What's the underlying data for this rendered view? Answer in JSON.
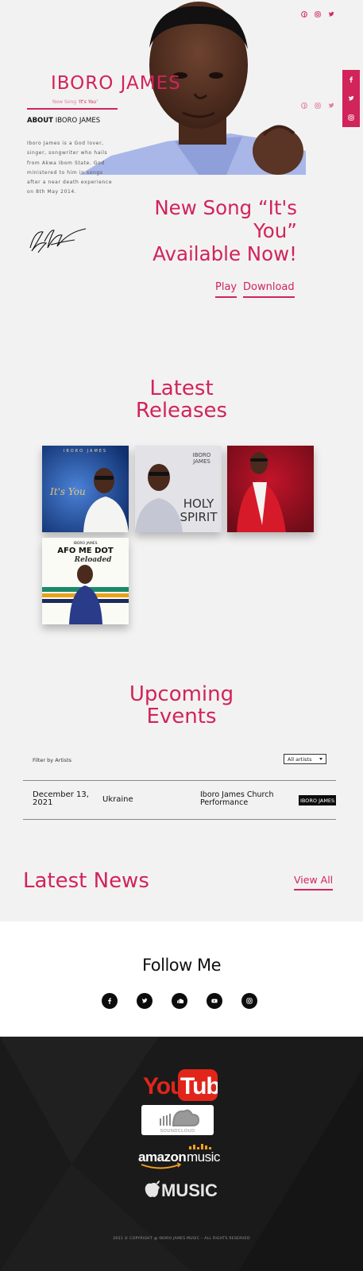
{
  "header": {
    "artist_name": "IBORO JAMES",
    "new_song_prefix": "New Song",
    "new_song_title": "‘It's You’",
    "about_label_bold": "ABOUT",
    "about_label_rest": "IBORO JAMES",
    "about_text": "Iboro James is a God lover, singer, songwriter who hails from Akwa Ibom State. God ministered to him in songs after a near death experience on 8th May 2014.",
    "social_icons": [
      "facebook-icon",
      "instagram-icon",
      "twitter-icon"
    ],
    "share_icons": [
      "facebook-icon",
      "twitter-icon",
      "instagram-icon"
    ]
  },
  "announcement": {
    "line1": "New Song “It's",
    "line2": "You”",
    "line3": "Available Now!",
    "play_label": "Play",
    "download_label": "Download"
  },
  "releases": {
    "title_line1": "Latest",
    "title_line2": "Releases",
    "covers": [
      {
        "name": "It's You",
        "header": "IBORO JAMES",
        "script": "It's You"
      },
      {
        "name": "Holy Spirit",
        "brand1": "IBORO",
        "brand2": "JAMES",
        "title1": "HOLY",
        "title2": "SPIRIT"
      },
      {
        "name": "Red suit portrait"
      },
      {
        "name": "Afo Me Dot Reloaded",
        "header": "IBORO JAMES",
        "title": "AFO ME DOT",
        "subtitle": "Reloaded"
      }
    ]
  },
  "events": {
    "title_line1": "Upcoming",
    "title_line2": "Events",
    "filter_label": "Filter by Artists",
    "filter_value": "All artists",
    "rows": [
      {
        "date_line1": "December 13,",
        "date_line2": "2021",
        "place": "Ukraine",
        "title_line1": "Iboro James Church",
        "title_line2": "Performance",
        "artist_badge": "IBORO JAMES"
      }
    ]
  },
  "news": {
    "title": "Latest News",
    "view_all_label": "View All"
  },
  "follow": {
    "title": "Follow Me",
    "icons": [
      "facebook-icon",
      "twitter-icon",
      "soundcloud-icon",
      "youtube-icon",
      "instagram-icon"
    ]
  },
  "footer": {
    "youtube_label1": "You",
    "youtube_label2": "Tube",
    "soundcloud_label": "SOUNDCLOUD",
    "amazon_label1": "amazon",
    "amazon_label2": "music",
    "apple_label": "MUSIC",
    "copyright": "2021 © COPYRIGHT @ IBORO JAMES MUSIC  –  ALL RIGHTS RESERVED"
  },
  "colors": {
    "accent": "#d1245a",
    "page_bg": "#f3f2f2",
    "footer_bg": "#1a1a1a"
  }
}
